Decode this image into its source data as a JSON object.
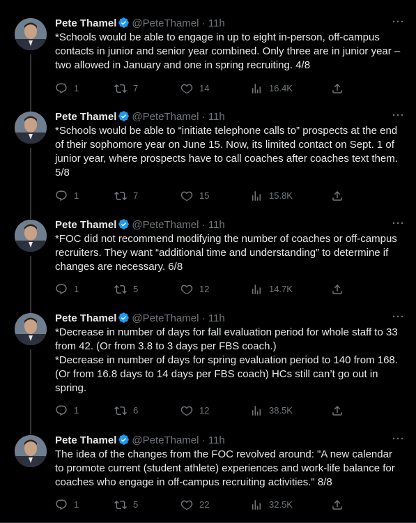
{
  "author": {
    "name": "Pete Thamel",
    "handle": "@PeteThamel",
    "dot": "·",
    "time": "11h"
  },
  "more_label": "···",
  "tweets": [
    {
      "text": "*Schools would be able to engage in up to eight in-person, off-campus contacts in junior and senior year combined. Only three are in junior year – two allowed in January and one in spring recruiting. 4/8",
      "replies": "1",
      "retweets": "7",
      "likes": "14",
      "views": "16.4K"
    },
    {
      "text": "*Schools would be able to “initiate telephone calls to” prospects at the end of their sophomore year on June 15. Now, its limited contact on Sept. 1 of junior year, where prospects have to call coaches after coaches text them. 5/8",
      "replies": "1",
      "retweets": "7",
      "likes": "15",
      "views": "15.8K"
    },
    {
      "text": "*FOC did not recommend modifying the number of coaches or off-campus recruiters. They want “additional time and understanding” to determine if changes are necessary. 6/8",
      "replies": "1",
      "retweets": "5",
      "likes": "12",
      "views": "14.7K"
    },
    {
      "text": "*Decrease in number of days for fall evaluation period for whole staff to 33 from 42. (Or from 3.8 to 3 days per FBS coach.)",
      "text2": "*Decrease in number of days for spring evaluation period to 140 from 168. (Or from 16.8 days to 14 days per FBS coach) HCs still can’t go out in spring.",
      "replies": "1",
      "retweets": "6",
      "likes": "12",
      "views": "38.5K"
    },
    {
      "text": "The idea of the changes from the FOC revolved around: \"A new calendar to promote current (student athlete) experiences and work-life balance for coaches who engage in off-campus recruiting activities.\" 8/8",
      "replies": "1",
      "retweets": "5",
      "likes": "22",
      "views": "32.5K"
    }
  ],
  "colors": {
    "background": "#000000",
    "text": "#e7e9ea",
    "muted": "#71767b",
    "verified": "#1d9bf0",
    "divider": "#2f3336"
  },
  "icons": {
    "verified": "verified-badge-icon",
    "reply": "reply-icon",
    "retweet": "retweet-icon",
    "like": "heart-icon",
    "views": "analytics-icon",
    "share": "share-icon",
    "more": "more-icon"
  }
}
